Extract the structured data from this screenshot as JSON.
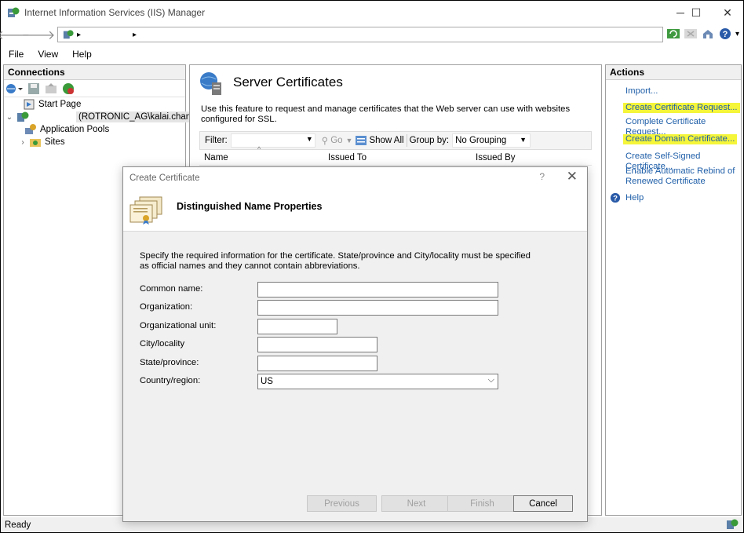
{
  "window": {
    "title": "Internet Information Services (IIS) Manager",
    "controls": {
      "minimize": "─",
      "maximize": "☐",
      "close": "✕"
    }
  },
  "address": {
    "back": "🡐",
    "forward": "🡒",
    "separator_1": "▸",
    "separator_2": "▸",
    "help_dropdown": "▾"
  },
  "menu": {
    "file": "File",
    "view": "View",
    "help": "Help"
  },
  "connections": {
    "header": "Connections",
    "tree": {
      "start_page": "Start Page",
      "server": "(ROTRONIC_AG\\kalai.chan)",
      "app_pools": "Application Pools",
      "sites": "Sites"
    }
  },
  "center": {
    "title": "Server Certificates",
    "description": "Use this feature to request and manage certificates that the Web server can use with websites configured for SSL.",
    "filter": {
      "label": "Filter:",
      "go": "Go",
      "show_all": "Show All",
      "group_by_label": "Group by:",
      "group_by_value": "No Grouping"
    },
    "columns": {
      "name": "Name",
      "issued_to": "Issued To",
      "issued_by": "Issued By"
    }
  },
  "actions": {
    "header": "Actions",
    "import": "Import...",
    "create_request": "Create Certificate Request...",
    "complete_request": "Complete Certificate Request...",
    "create_domain": "Create Domain Certificate...",
    "create_self_signed": "Create Self-Signed Certificate...",
    "rebind_line1": "Enable Automatic Rebind of",
    "rebind_line2": "Renewed Certificate",
    "help": "Help",
    "highlight_color": "#f5f53a"
  },
  "status": {
    "text": "Ready"
  },
  "dialog": {
    "title": "Create Certificate",
    "help_glyph": "?",
    "close_glyph": "✕",
    "header": "Distinguished Name Properties",
    "instructions": "Specify the required information for the certificate. State/province and City/locality must be specified as official names and they cannot contain abbreviations.",
    "fields": {
      "common_name": {
        "label": "Common name:",
        "value": ""
      },
      "organization": {
        "label": "Organization:",
        "value": ""
      },
      "org_unit": {
        "label": "Organizational unit:",
        "value": ""
      },
      "city": {
        "label": "City/locality",
        "value": ""
      },
      "state": {
        "label": "State/province:",
        "value": ""
      },
      "country": {
        "label": "Country/region:",
        "value": "US"
      }
    },
    "buttons": {
      "previous": "Previous",
      "next": "Next",
      "finish": "Finish",
      "cancel": "Cancel"
    }
  }
}
